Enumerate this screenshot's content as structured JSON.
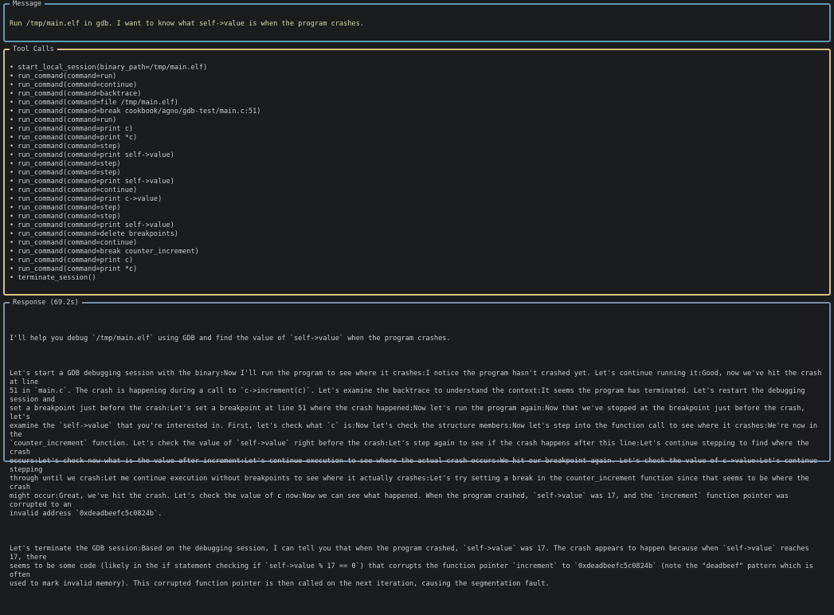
{
  "message": {
    "title": "Message",
    "text": "Run /tmp/main.elf in gdb. I want to know what self->value is when the program crashes."
  },
  "tool_calls": {
    "title": "Tool Calls",
    "bullet": "•",
    "items": [
      "start_local_session(binary_path=/tmp/main.elf)",
      "run_command(command=run)",
      "run_command(command=continue)",
      "run_command(command=backtrace)",
      "run_command(command=file /tmp/main.elf)",
      "run_command(command=break cookbook/agno/gdb-test/main.c:51)",
      "run_command(command=run)",
      "run_command(command=print c)",
      "run_command(command=print *c)",
      "run_command(command=step)",
      "run_command(command=print self->value)",
      "run_command(command=step)",
      "run_command(command=step)",
      "run_command(command=print self->value)",
      "run_command(command=continue)",
      "run_command(command=print c->value)",
      "run_command(command=step)",
      "run_command(command=step)",
      "run_command(command=print self->value)",
      "run_command(command=delete breakpoints)",
      "run_command(command=continue)",
      "run_command(command=break counter_increment)",
      "run_command(command=print c)",
      "run_command(command=print *c)",
      "terminate_session()"
    ]
  },
  "response": {
    "title": "Response (69.2s)",
    "paragraphs": [
      "I'll help you debug `/tmp/main.elf` using GDB and find the value of `self->value` when the program crashes.",
      "Let's start a GDB debugging session with the binary:Now I'll run the program to see where it crashes:I notice the program hasn't crashed yet. Let's continue running it:Good, now we've hit the crash at line\n51 in `main.c`. The crash is happening during a call to `c->increment(c)`. Let's examine the backtrace to understand the context:It seems the program has terminated. Let's restart the debugging session and\nset a breakpoint just before the crash:Let's set a breakpoint at line 51 where the crash happened:Now let's run the program again:Now that we've stopped at the breakpoint just before the crash, let's\nexamine the `self->value` that you're interested in. First, let's check what `c` is:Now let's check the structure members:Now let's step into the function call to see where it crashes:We're now in the\n`counter_increment` function. Let's check the value of `self->value` right before the crash:Let's step again to see if the crash happens after this line:Let's continue stepping to find where the crash\noccurs:Let's check now what is the value after increment:Let's continue execution to see where the actual crash occurs:We hit our breakpoint again. Let's check the value of c->value:Let's continue stepping\nthrough until we crash:Let me continue execution without breakpoints to see where it actually crashes:Let's try setting a break in the counter_increment function since that seems to be where the crash\nmight occur:Great, we've hit the crash. Let's check the value of c now:Now we can see what happened. When the program crashed, `self->value` was 17, and the `increment` function pointer was corrupted to an\ninvalid address `0xdeadbeefc5c0824b`.",
      "Let's terminate the GDB session:Based on the debugging session, I can tell you that when the program crashed, `self->value` was 17. The crash appears to happen because when `self->value` reaches 17, there\nseems to be some code (likely in the if statement checking if `self->value % 17 == 0`) that corrupts the function pointer `increment` to `0xdeadbeefc5c0824b` (note the \"deadbeef\" pattern which is often\nused to mark invalid memory). This corrupted function pointer is then called on the next iteration, causing the segmentation fault."
    ]
  }
}
